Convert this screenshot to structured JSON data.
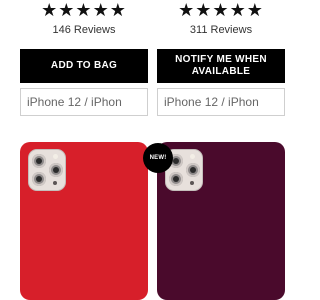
{
  "products": [
    {
      "rating_stars": "★★★★★",
      "reviews": "146 Reviews",
      "button_label": "ADD TO BAG",
      "model_select_value": "iPhone 12 / iPhon",
      "case_color": "#d71f2a"
    },
    {
      "rating_stars": "★★★★★",
      "reviews": "311 Reviews",
      "button_label": "NOTIFY ME WHEN AVAILABLE",
      "model_select_value": "iPhone 12 / iPhon",
      "case_color": "#4a0a2c",
      "badge": "NEW!"
    }
  ],
  "icons": [
    "star-icon",
    "camera-module-icon"
  ]
}
